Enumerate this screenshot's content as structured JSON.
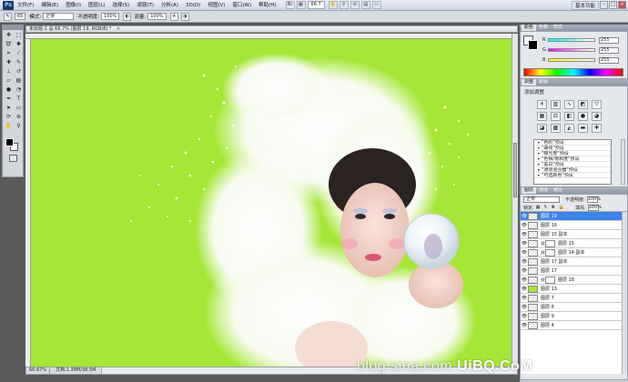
{
  "menubar": {
    "logo": "Ps",
    "items": [
      "文件(F)",
      "编辑(E)",
      "图像(I)",
      "图层(L)",
      "选择(S)",
      "滤镜(T)",
      "分析(A)",
      "3D(D)",
      "视图(V)",
      "窗口(W)",
      "帮助(H)"
    ],
    "zoom": "66.7",
    "workspace": "基本功能"
  },
  "options": {
    "mode_label": "模式:",
    "mode_value": "正常",
    "opacity_label": "不透明度:",
    "opacity_value": "100%",
    "flow_label": "流量:",
    "flow_value": "100%",
    "brush_size": "65"
  },
  "document": {
    "tab_title": "未标题-1 @ 66.7% (图层 19, RGB/8) *",
    "status_zoom": "66.67%",
    "status_doc": "文档:1.38M/38.5M"
  },
  "color_panel": {
    "tabs": [
      "颜色",
      "色板",
      "样式"
    ],
    "r_value": "255",
    "g_value": "255",
    "b_value": "255"
  },
  "adjust_panel": {
    "tabs": [
      "调整",
      "蒙版"
    ],
    "title": "添加调整",
    "presets": [
      "\"色阶\"预设",
      "\"曲线\"预设",
      "\"曝光度\"预设",
      "\"色相/饱和度\"预设",
      "\"黑白\"预设",
      "\"通道混合器\"预设",
      "\"可选颜色\"预设"
    ]
  },
  "layers_panel": {
    "tabs": [
      "图层",
      "通道",
      "路径"
    ],
    "blend_mode": "正常",
    "opacity_label": "不透明度:",
    "opacity_value": "100%",
    "lock_label": "锁定:",
    "fill_label": "填充:",
    "fill_value": "100%",
    "layers": [
      {
        "name": "图层 19",
        "selected": true,
        "mask": false
      },
      {
        "name": "图层 16",
        "selected": false,
        "mask": false
      },
      {
        "name": "图层 15 副本",
        "selected": false,
        "mask": false
      },
      {
        "name": "图层 15",
        "selected": false,
        "mask": true
      },
      {
        "name": "图层 14 副本",
        "selected": false,
        "mask": true
      },
      {
        "name": "图层 17 副本",
        "selected": false,
        "mask": false
      },
      {
        "name": "图层 17",
        "selected": false,
        "mask": false
      },
      {
        "name": "图层 18",
        "selected": false,
        "mask": true
      },
      {
        "name": "图层 13",
        "selected": false,
        "mask": false,
        "green": true
      },
      {
        "name": "图层 7",
        "selected": false,
        "mask": false
      },
      {
        "name": "图层 8",
        "selected": false,
        "mask": false
      },
      {
        "name": "图层 9",
        "selected": false,
        "mask": false
      },
      {
        "name": "图层 4",
        "selected": false,
        "mask": false
      }
    ]
  },
  "colors": {
    "canvas": "#a5e636",
    "selected_layer": "#3d83e8"
  },
  "watermark": {
    "site": "blog.sina.com",
    "brand": "UiBQ.CoM"
  }
}
